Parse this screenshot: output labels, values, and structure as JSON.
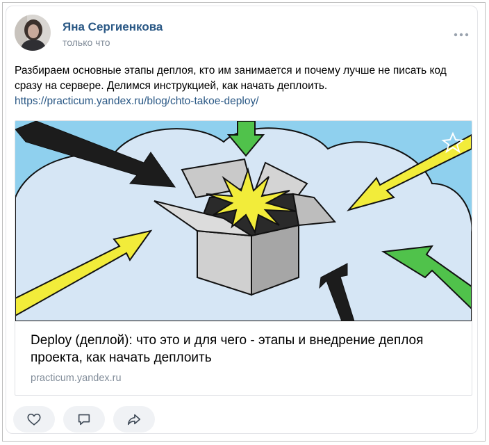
{
  "post": {
    "author": "Яна Сергиенкова",
    "time": "только что",
    "text": "Разбираем основные этапы деплоя, кто им занимается и почему лучше не писать код сразу на сервере. Делимся инструкцией, как начать деплоить.",
    "link": "https://practicum.yandex.ru/blog/chto-takoe-deploy/"
  },
  "attachment": {
    "title": "Deploy (деплой): что это и для чего - этапы и внедрение деплоя проекта, как начать деплоить",
    "domain": "practicum.yandex.ru"
  },
  "icons": {
    "more": "more-dots-icon",
    "like": "heart-icon",
    "comment": "comment-icon",
    "share": "share-icon",
    "bookmark": "star-icon"
  },
  "colors": {
    "author": "#2a5885",
    "muted": "#818c99",
    "sky": "#8fd0ee",
    "cloud": "#d6e6f5",
    "green_arrow": "#50c24b",
    "yellow_arrow": "#f2ec3a"
  }
}
